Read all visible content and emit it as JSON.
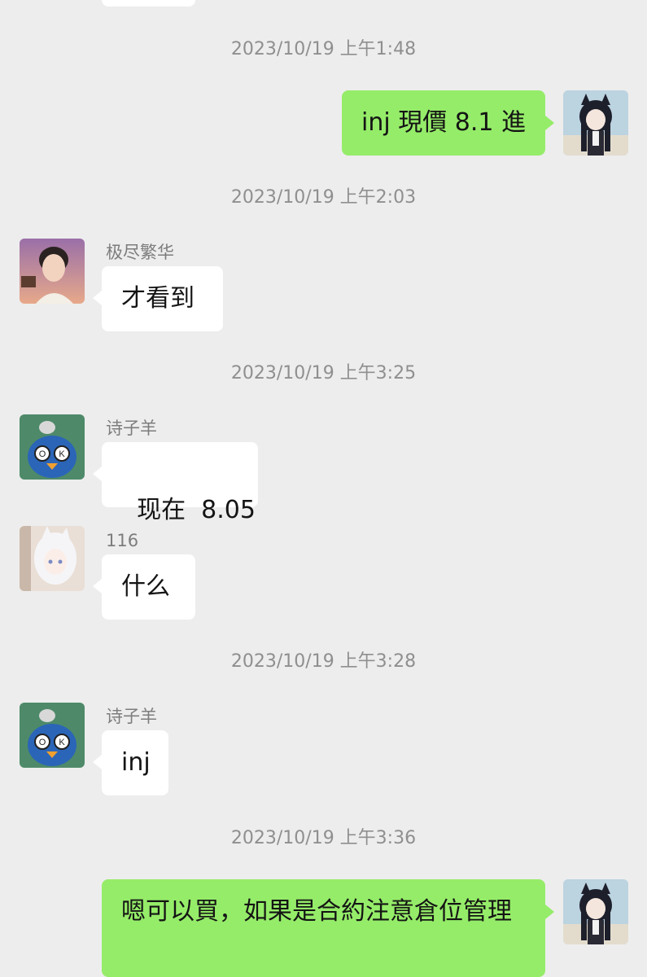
{
  "chat": {
    "timestamps": [
      "2023/10/19 上午1:48",
      "2023/10/19 上午2:03",
      "2023/10/19 上午3:25",
      "2023/10/19 上午3:28",
      "2023/10/19 上午3:36"
    ],
    "messages": [
      {
        "sender": "me",
        "text": "inj 現價 8.1 進",
        "avatar": "catgirl-avatar-icon"
      },
      {
        "sender": "极尽繁华",
        "text": "才看到",
        "avatar": "boy-avatar-icon"
      },
      {
        "sender": "诗子羊",
        "text": "现在  8.05",
        "avatar": "penguin-avatar-icon"
      },
      {
        "sender": "116",
        "text": "什么",
        "avatar": "anime-white-hair-avatar-icon"
      },
      {
        "sender": "诗子羊",
        "text": "inj",
        "avatar": "penguin-avatar-icon"
      },
      {
        "sender": "me",
        "text": "嗯可以買，如果是合約注意倉位管理",
        "avatar": "catgirl-avatar-icon"
      }
    ]
  },
  "colors": {
    "background": "#ededed",
    "outgoing_bubble": "#95ec69",
    "incoming_bubble": "#ffffff",
    "timestamp_text": "#8f8f8f",
    "sender_name": "#7d7d7d"
  }
}
